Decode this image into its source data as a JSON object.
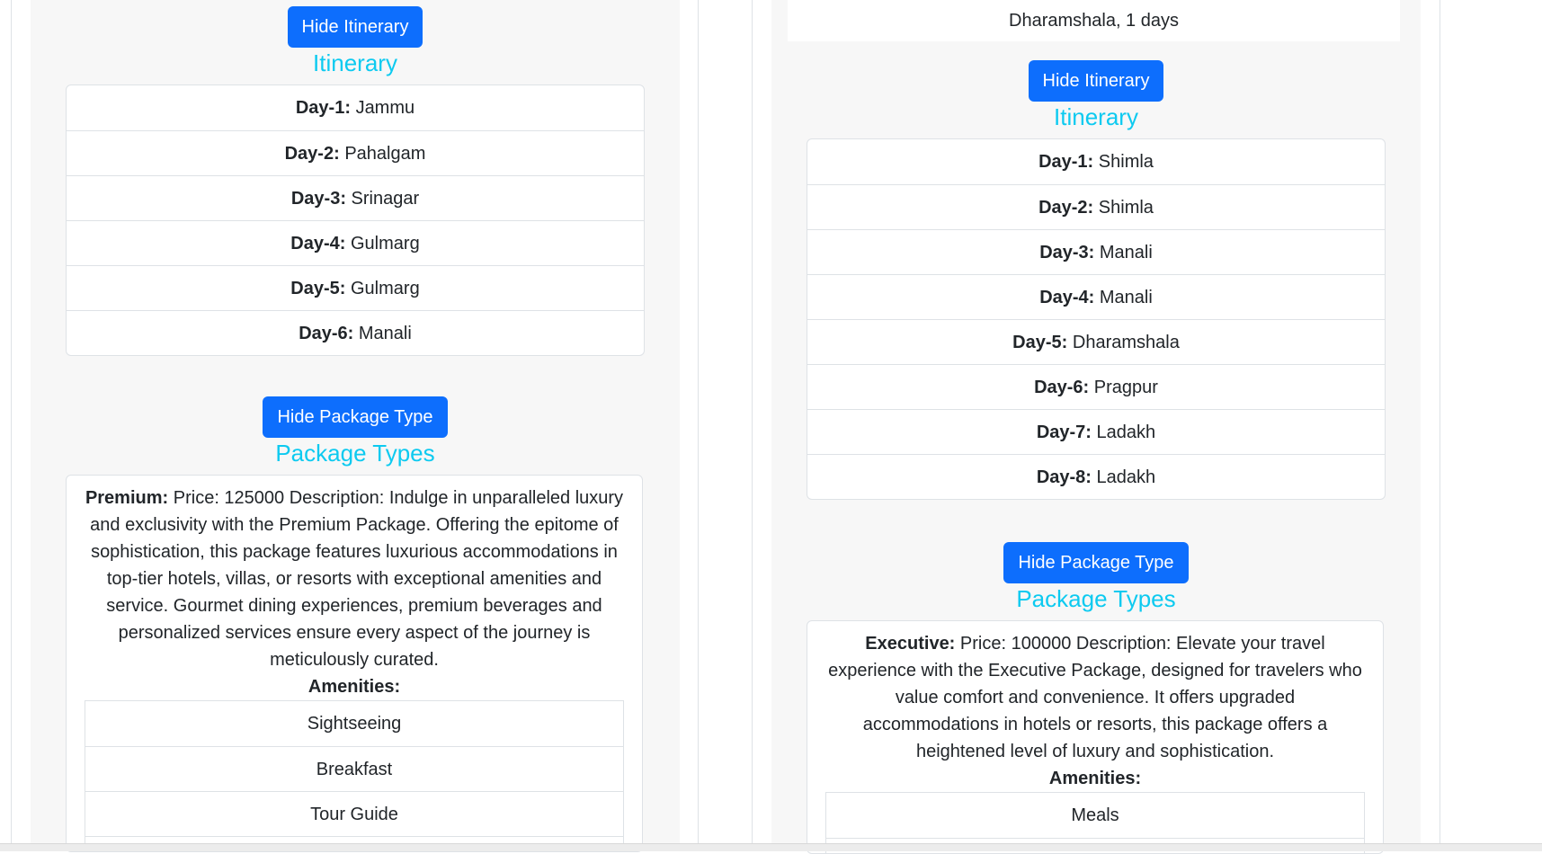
{
  "left_card": {
    "itinerary_button": "Hide Itinerary",
    "itinerary_heading": "Itinerary",
    "itinerary": [
      {
        "day": "Day-1:",
        "place": "Jammu"
      },
      {
        "day": "Day-2:",
        "place": "Pahalgam"
      },
      {
        "day": "Day-3:",
        "place": "Srinagar"
      },
      {
        "day": "Day-4:",
        "place": "Gulmarg"
      },
      {
        "day": "Day-5:",
        "place": "Gulmarg"
      },
      {
        "day": "Day-6:",
        "place": "Manali"
      }
    ],
    "package_button": "Hide Package Type",
    "package_heading": "Package Types",
    "package": {
      "name": "Premium:",
      "text": "Price: 125000 Description: Indulge in unparalleled luxury and exclusivity with the Premium Package. Offering the epitome of sophistication, this package features luxurious accommodations in top-tier hotels, villas, or resorts with exceptional amenities and service. Gourmet dining experiences, premium beverages and personalized services ensure every aspect of the journey is meticulously curated.",
      "amenities_label": "Amenities:",
      "amenities": [
        "Sightseeing",
        "Breakfast",
        "Tour Guide"
      ]
    }
  },
  "right_card": {
    "top_info": "Dharamshala, 1 days",
    "itinerary_button": "Hide Itinerary",
    "itinerary_heading": "Itinerary",
    "itinerary": [
      {
        "day": "Day-1:",
        "place": "Shimla"
      },
      {
        "day": "Day-2:",
        "place": "Shimla"
      },
      {
        "day": "Day-3:",
        "place": "Manali"
      },
      {
        "day": "Day-4:",
        "place": "Manali"
      },
      {
        "day": "Day-5:",
        "place": "Dharamshala"
      },
      {
        "day": "Day-6:",
        "place": "Pragpur"
      },
      {
        "day": "Day-7:",
        "place": "Ladakh"
      },
      {
        "day": "Day-8:",
        "place": "Ladakh"
      }
    ],
    "package_button": "Hide Package Type",
    "package_heading": "Package Types",
    "package": {
      "name": "Executive:",
      "text": "Price: 100000 Description: Elevate your travel experience with the Executive Package, designed for travelers who value comfort and convenience. It offers upgraded accommodations in hotels or resorts, this package offers a heightened level of luxury and sophistication.",
      "amenities_label": "Amenities:",
      "amenities": [
        "Meals"
      ]
    }
  }
}
